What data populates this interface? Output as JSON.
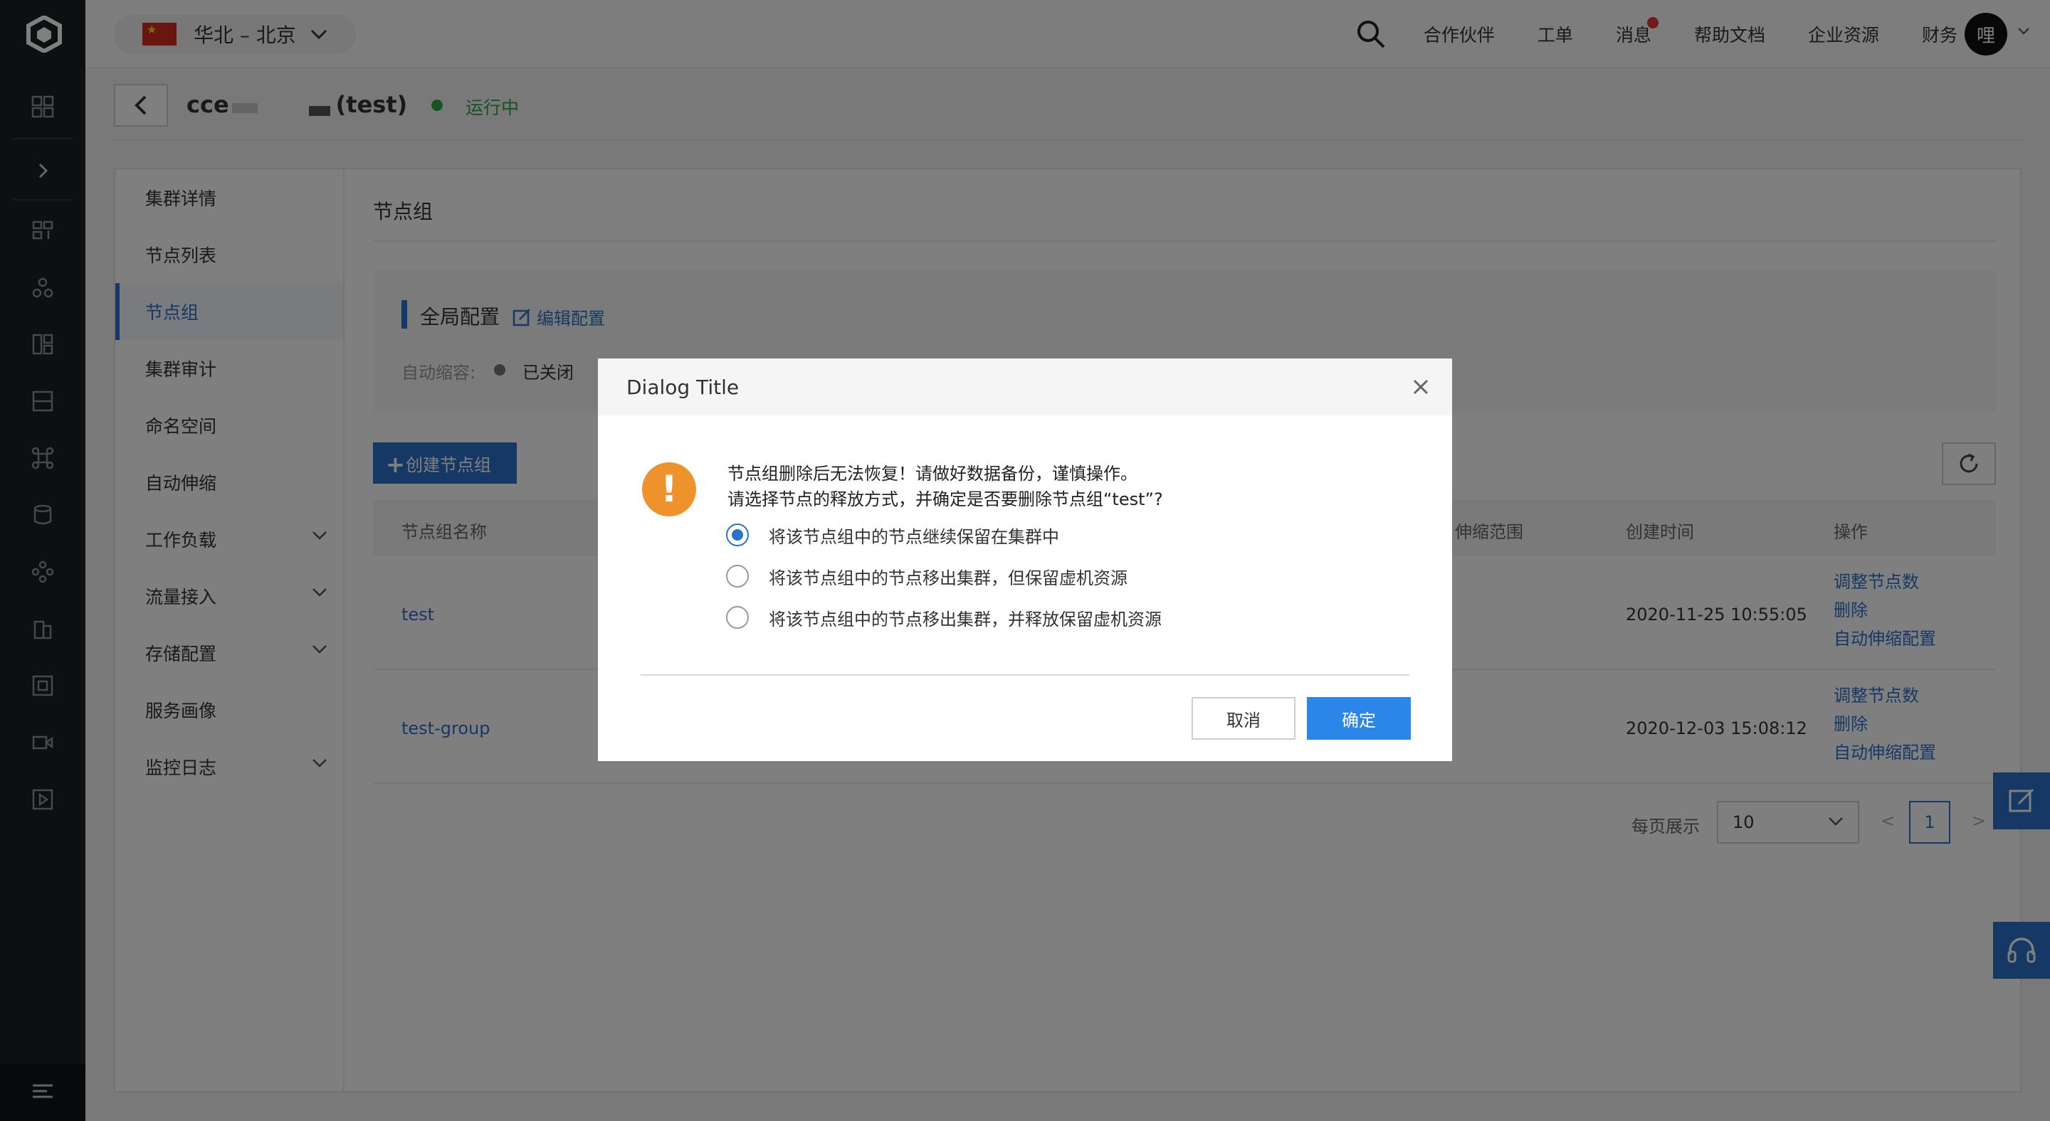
{
  "topbar": {
    "region": "华北 – 北京",
    "nav": [
      "合作伙伴",
      "工单",
      "消息",
      "帮助文档",
      "企业资源",
      "财务"
    ],
    "avatar": "哩"
  },
  "cluster": {
    "name_prefix": "cce",
    "name_suffix": "(test)",
    "status": "运行中"
  },
  "sidemenu": [
    {
      "label": "集群详情"
    },
    {
      "label": "节点列表"
    },
    {
      "label": "节点组"
    },
    {
      "label": "集群审计"
    },
    {
      "label": "命名空间"
    },
    {
      "label": "自动伸缩"
    },
    {
      "label": "工作负载"
    },
    {
      "label": "流量接入"
    },
    {
      "label": "存储配置"
    },
    {
      "label": "服务画像"
    },
    {
      "label": "监控日志"
    }
  ],
  "content": {
    "section_title": "节点组",
    "global_config": {
      "title": "全局配置",
      "edit": "编辑配置",
      "autoscale_label": "自动缩容:",
      "autoscale_value": "已关闭"
    },
    "create_button": "创建节点组",
    "table": {
      "headers": [
        "节点组名称",
        "伸缩范围",
        "创建时间",
        "操作"
      ],
      "rows": [
        {
          "name": "test",
          "created": "2020-11-25 10:55:05"
        },
        {
          "name": "test-group",
          "created": "2020-12-03 15:08:12"
        }
      ],
      "ops": [
        "调整节点数",
        "删除",
        "自动伸缩配置"
      ]
    },
    "pager": {
      "label": "每页展示",
      "page_size": "10",
      "page": "1",
      "prev": "<",
      "next": ">"
    }
  },
  "dialog": {
    "title": "Dialog Title",
    "line1": "节点组删除后无法恢复！请做好数据备份，谨慎操作。",
    "line2": "请选择节点的释放方式，并确定是否要删除节点组“test”?",
    "options": [
      "将该节点组中的节点继续保留在集群中",
      "将该节点组中的节点移出集群，但保留虚机资源",
      "将该节点组中的节点移出集群，并释放保留虚机资源"
    ],
    "cancel": "取消",
    "ok": "确定"
  },
  "colors": {
    "accent": "#2a73c9",
    "warning": "#f0922b",
    "running": "#2ca84a"
  }
}
